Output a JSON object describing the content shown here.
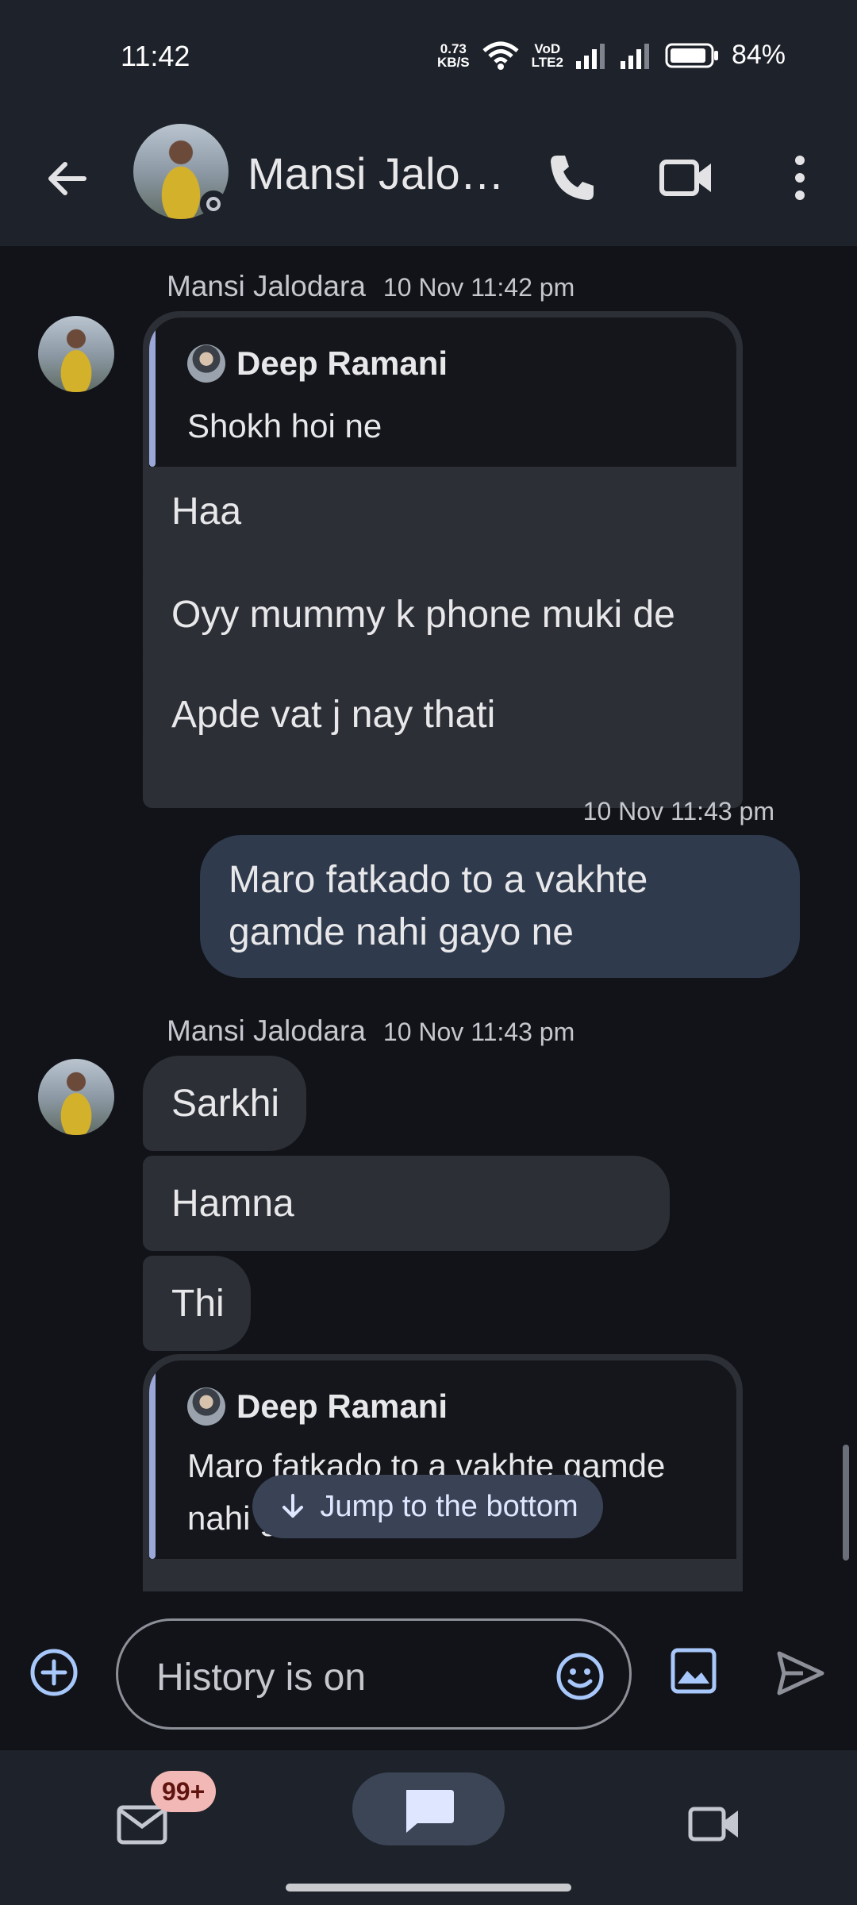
{
  "status_bar": {
    "time": "11:42",
    "net_speed_value": "0.73",
    "net_speed_unit": "KB/S",
    "network_label_top": "VoD",
    "network_label_bottom": "LTE2",
    "battery": "84%"
  },
  "header": {
    "contact_name": "Mansi Jalo…",
    "icons": [
      "back-arrow-icon",
      "phone-icon",
      "video-call-icon",
      "more-vert-icon"
    ]
  },
  "messages": {
    "group1": {
      "sender": "Mansi Jalodara",
      "timestamp": "10 Nov 11:42 pm",
      "reply": {
        "author": "Deep Ramani",
        "text": "Shokh hoi ne"
      },
      "bubbles": [
        "Haa",
        "Oyy mummy k phone muki de",
        "Apde vat j nay thati"
      ]
    },
    "outgoing": {
      "timestamp": "10 Nov 11:43 pm",
      "line1": "Maro fatkado to a vakhte",
      "line2": "gamde nahi gayo ne"
    },
    "group2": {
      "sender": "Mansi Jalodara",
      "timestamp": "10 Nov 11:43 pm",
      "bubbles": [
        "Sarkhi",
        "Hamna",
        "Thi"
      ],
      "reply": {
        "author": "Deep Ramani",
        "line1": "Maro fatkado to a vakhte gamde",
        "line2": "nahi g"
      }
    }
  },
  "jump_button": {
    "label": "Jump to the bottom"
  },
  "composer": {
    "placeholder": "History is on"
  },
  "bottom_nav": {
    "mail_badge": "99+"
  },
  "colors": {
    "background": "#111318",
    "bar": "#1e222a",
    "incoming_bubble": "#2c2f36",
    "outgoing_bubble": "#2f3a4d",
    "accent": "#a8c7fa"
  }
}
